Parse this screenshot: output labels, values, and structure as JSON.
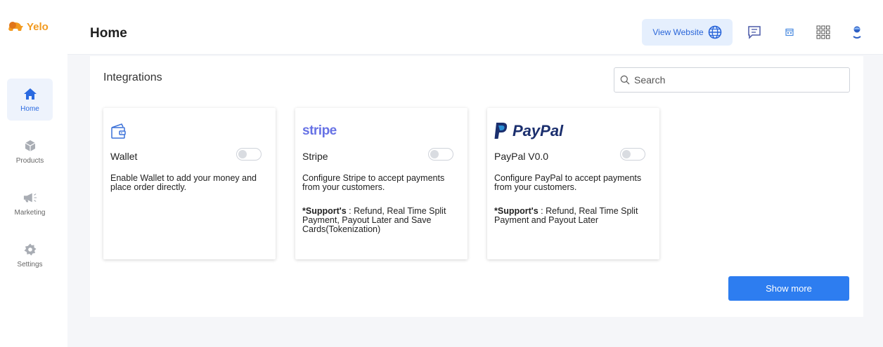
{
  "app": {
    "logo_text": "Yelo",
    "brand_color": "#f29a1f",
    "accent_color": "#2d7df0"
  },
  "sidebar": {
    "items": [
      {
        "label": "Home",
        "icon": "home-icon",
        "active": true
      },
      {
        "label": "Products",
        "icon": "box-icon",
        "active": false
      },
      {
        "label": "Marketing",
        "icon": "megaphone-icon",
        "active": false
      },
      {
        "label": "Settings",
        "icon": "gear-icon",
        "active": false
      }
    ]
  },
  "header": {
    "title": "Home",
    "view_website_label": "View Website",
    "icons": [
      "globe-icon",
      "chat-icon",
      "calendar-icon",
      "apps-grid-icon",
      "user-avatar-icon"
    ]
  },
  "integrations": {
    "title": "Integrations",
    "search_placeholder": "Search",
    "cards": [
      {
        "name": "Wallet",
        "logo": "wallet-icon",
        "enabled": false,
        "description": "Enable Wallet to add your money and place order directly.",
        "support_label": "",
        "support_text": ""
      },
      {
        "name": "Stripe",
        "logo_text": "stripe",
        "enabled": false,
        "description": "Configure Stripe to accept payments from your customers.",
        "support_label": "*Support's",
        "support_text": " : Refund, Real Time Split Payment, Payout Later and Save Cards(Tokenization)"
      },
      {
        "name": "PayPal V0.0",
        "logo_text": "PayPal",
        "enabled": false,
        "description": "Configure PayPal to accept payments from your customers.",
        "support_label": "*Support's",
        "support_text": " : Refund, Real Time Split Payment and Payout Later"
      }
    ],
    "show_more_label": "Show more"
  }
}
